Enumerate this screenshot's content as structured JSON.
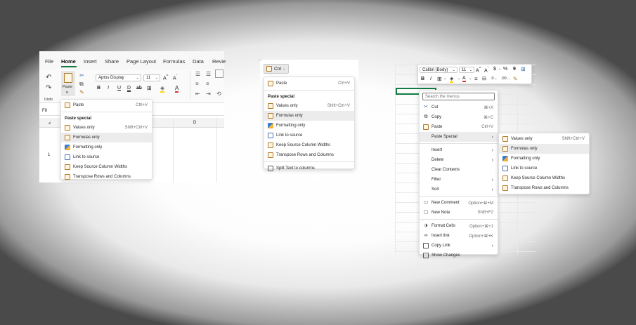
{
  "panel1": {
    "tabs": [
      "File",
      "Home",
      "Insert",
      "Share",
      "Page Layout",
      "Formulas",
      "Data",
      "Revie"
    ],
    "paste_label": "Paste",
    "undo_label": "Undo",
    "font_name": "Aptos Display",
    "font_size": "11",
    "name_box": "F8",
    "col_d": "D",
    "row_1": "1",
    "menu": {
      "paste": "Paste",
      "paste_shortcut": "Ctrl+V",
      "section": "Paste special",
      "values_only": "Values only",
      "values_shortcut": "Shift+Ctrl+V",
      "formulas_only": "Formulas only",
      "formatting_only": "Formatting only",
      "link_to_source": "Link to source",
      "keep_widths": "Keep Source Column Widths",
      "transpose": "Transpose Rows and Columns"
    }
  },
  "panel2": {
    "ctrl_label": "Ctrl",
    "menu": {
      "paste": "Paste",
      "paste_shortcut": "Ctrl+V",
      "section": "Paste special",
      "values_only": "Values only",
      "values_shortcut": "Shift+Ctrl+V",
      "formulas_only": "Formulas only",
      "formatting_only": "Formatting only",
      "link_to_source": "Link to source",
      "keep_widths": "Keep Source Column Widths",
      "transpose": "Transpose Rows and Columns",
      "split_text": "Split Text to columns"
    }
  },
  "panel3": {
    "font_name": "Calibri (Body)",
    "font_size": "11",
    "search_placeholder": "Search the menus",
    "menu": {
      "cut": "Cut",
      "cut_shortcut": "⌘+X",
      "copy": "Copy",
      "copy_shortcut": "⌘+C",
      "paste": "Paste",
      "paste_shortcut": "Ctrl+V",
      "paste_special": "Paste Special",
      "insert": "Insert",
      "delete": "Delete",
      "clear_contents": "Clear Contents",
      "filter": "Filter",
      "sort": "Sort",
      "new_comment": "New Comment",
      "new_comment_shortcut": "Option+⌘+M",
      "new_note": "New Note",
      "new_note_shortcut": "Shift+F2",
      "format_cells": "Format Cells",
      "format_cells_shortcut": "Option+⌘+1",
      "insert_link": "Insert link",
      "insert_link_shortcut": "Option+⌘+K",
      "copy_link": "Copy Link",
      "show_changes": "Show Changes"
    },
    "submenu": {
      "values_only": "Values only",
      "values_shortcut": "Shift+Ctrl+V",
      "formulas_only": "Formulas only",
      "formatting_only": "Formatting only",
      "link_to_source": "Link to source",
      "keep_widths": "Keep Source Column Widths",
      "transpose": "Transpose Rows and Columns"
    }
  },
  "colors": {
    "accent_green": "#107c41",
    "font_red": "#d13438",
    "highlight_yellow": "#ffd800"
  }
}
